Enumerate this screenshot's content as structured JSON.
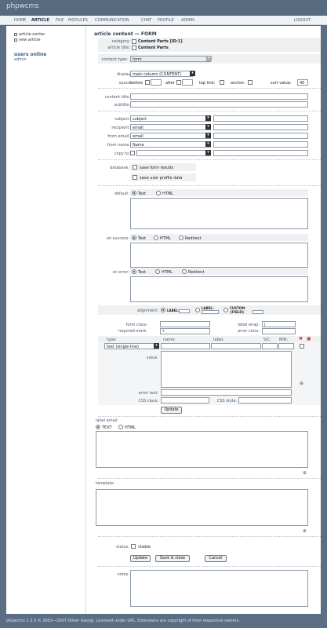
{
  "brand": {
    "name": "phpwcms"
  },
  "nav": {
    "home": "HOME",
    "article": "ARTICLE",
    "file": "FILE",
    "modules": "MODULES",
    "communication": "COMMUNICATION",
    "chat": "CHAT",
    "profile": "PROFILE",
    "admin": "ADMIN",
    "logout": "LOGOUT"
  },
  "sidebar": {
    "article_center": "article center",
    "new_article": "new article",
    "users_online": "users online",
    "user": "admin"
  },
  "title": "article content — FORM",
  "head": {
    "category_label": "category:",
    "category_value": "Content Parts [ID:1]",
    "article_label": "article title:",
    "article_value": "Content Parts"
  },
  "content_type": {
    "label": "content type:",
    "value": "form"
  },
  "display": {
    "label": "display:",
    "value": "main column (CONTENT)"
  },
  "space": {
    "label": "space:",
    "before": "before",
    "after": "after",
    "top_link": "top link:",
    "anchor": "anchor:",
    "sort_label": "sort value:",
    "sort_value": "40"
  },
  "content_title": "content title:",
  "subtitle": "subtitle:",
  "mail": {
    "subject_label": "subject:",
    "subject_value": "subject",
    "recipient_label": "recipient:",
    "recipient_value": "email",
    "from_email_label": "from email:",
    "from_email_value": "email",
    "from_name_label": "from name:",
    "from_name_value": "Name",
    "copy_to_label": "copy to:"
  },
  "database": {
    "label": "database:",
    "save_results": "save form results",
    "save_profile": "save user profile data"
  },
  "default": {
    "label": "default:",
    "text": "Text",
    "html": "HTML"
  },
  "on_success": {
    "label": "on success:",
    "text": "Text",
    "html": "HTML",
    "redirect": "Redirect"
  },
  "on_error": {
    "label": "on error:",
    "text": "Text",
    "html": "HTML",
    "redirect": "Redirect"
  },
  "alignment": {
    "label": "alignment:",
    "opt1": "LABEL:",
    "opt2": "LABEL:",
    "opt3": "CUSTOM {FIELD}"
  },
  "form": {
    "form_class": "form class:",
    "required_mark": "required mark:",
    "required_value": "*",
    "label_wrap": "label wrap:",
    "label_wrap_value": "|",
    "error_class": "error class:"
  },
  "field_cols": {
    "type": "type:",
    "name": "name:",
    "label": "label:",
    "sc": "S/C:",
    "mr": "M/R:"
  },
  "field": {
    "type_value": "text (single-line)",
    "value_label": "value:",
    "error_text": "error text:",
    "css_class": "CSS class:",
    "css_style": "CSS style:",
    "update": "Update"
  },
  "label_email": {
    "label": "label email:",
    "text": "TEXT",
    "html": "HTML"
  },
  "template": {
    "label": "template:"
  },
  "status": {
    "label": "status:",
    "visible": "visible"
  },
  "buttons": {
    "update": "Update",
    "save_close": "Save & close",
    "cancel": "Cancel"
  },
  "notes": {
    "label": "notes:"
  },
  "footer": "phpwcms 1.3.3 © 2003—2007 Oliver Georgi. Licensed under GPL. Extensions are copyright of their respective owners."
}
